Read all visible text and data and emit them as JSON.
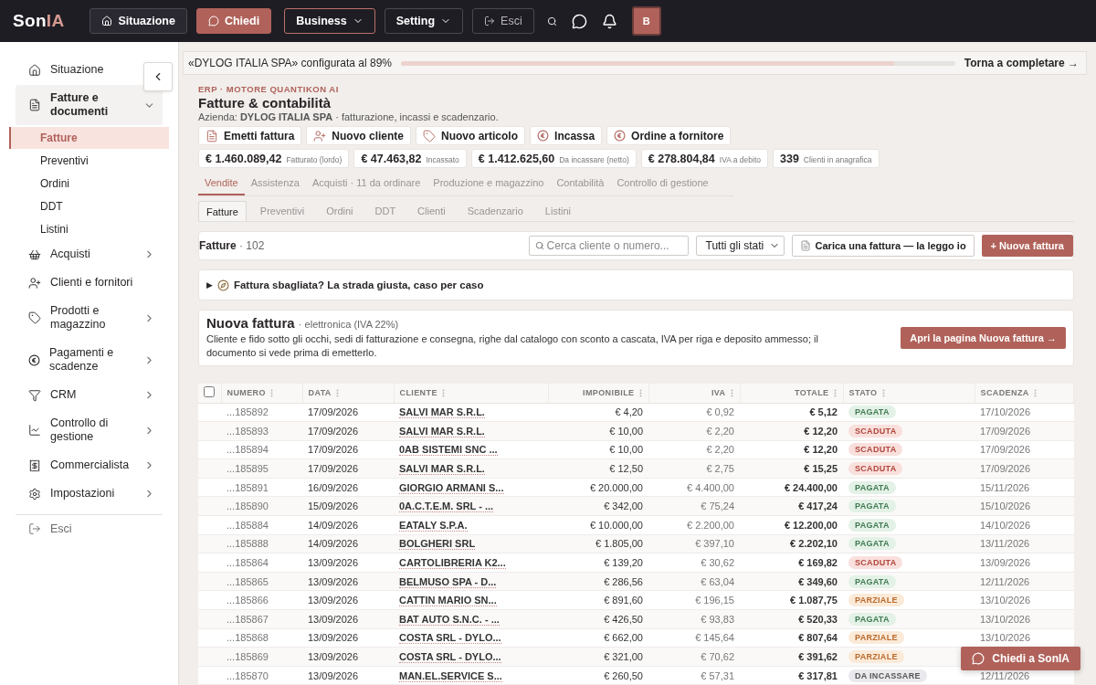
{
  "topbar": {
    "logo": {
      "text": "Son",
      "accent": "IA"
    },
    "nav": [
      {
        "label": "Situazione",
        "kind": "home"
      },
      {
        "label": "Chiedi",
        "kind": "primary"
      },
      {
        "label": "Business",
        "kind": "menu",
        "selected": true
      },
      {
        "label": "Setting",
        "kind": "menu",
        "selected": false
      },
      {
        "label": "Esci",
        "kind": "logout"
      }
    ],
    "avatar": "B"
  },
  "sidebar": {
    "items": [
      {
        "label": "Situazione",
        "kind": "link",
        "selected": false
      },
      {
        "label": "Fatture e documenti",
        "kind": "group",
        "selected": true,
        "expanded": true,
        "children": [
          {
            "label": "Fatture",
            "selected": true
          },
          {
            "label": "Preventivi",
            "selected": false
          },
          {
            "label": "Ordini",
            "selected": false
          },
          {
            "label": "DDT",
            "selected": false
          },
          {
            "label": "Listini",
            "selected": false
          }
        ]
      },
      {
        "label": "Acquisti",
        "kind": "group",
        "selected": false,
        "expanded": false
      },
      {
        "label": "Clienti e fornitori",
        "kind": "link",
        "selected": false
      },
      {
        "label": "Prodotti e magazzino",
        "kind": "group",
        "selected": false,
        "expanded": false
      },
      {
        "label": "Pagamenti e scadenze",
        "kind": "group",
        "selected": false,
        "expanded": false
      },
      {
        "label": "CRM",
        "kind": "group",
        "selected": false,
        "expanded": false
      },
      {
        "label": "Controllo di gestione",
        "kind": "group",
        "selected": false,
        "expanded": false
      },
      {
        "label": "Commercialista",
        "kind": "group",
        "selected": false,
        "expanded": false
      },
      {
        "label": "Impostazioni",
        "kind": "group",
        "selected": false,
        "expanded": false
      }
    ],
    "footer": "Esci"
  },
  "setup_banner": {
    "text": "«DYLOG ITALIA SPA» configurata al 89%",
    "level": 0.89,
    "link": "Torna a completare →"
  },
  "header": {
    "eyebrow": "ERP · MOTORE QUANTIKON AI",
    "title": "Fatture & contabilità",
    "subtitle": "Azienda: **DYLOG ITALIA SPA** · fatturazione, incassi e scadenzario."
  },
  "actions": [
    "Emetti fattura",
    "Nuovo cliente",
    "Nuovo articolo",
    "Incassa",
    "Ordine a fornitore"
  ],
  "kpis": [
    {
      "value": "€ 1.460.089,42",
      "label": "Fatturato (lordo)"
    },
    {
      "value": "€ 47.463,82",
      "label": "Incassato"
    },
    {
      "value": "€ 1.412.625,60",
      "label": "Da incassare (netto)"
    },
    {
      "value": "€ 278.804,84",
      "label": "IVA a debito"
    },
    {
      "value": "339",
      "label": "Clienti in anagrafica"
    }
  ],
  "tabs": [
    {
      "label": "Vendite",
      "selected": true
    },
    {
      "label": "Assistenza",
      "selected": false
    },
    {
      "label": "Acquisti · 11 da ordinare",
      "selected": false
    },
    {
      "label": "Produzione e magazzino",
      "selected": false
    },
    {
      "label": "Contabilità",
      "selected": false
    },
    {
      "label": "Controllo di gestione",
      "selected": false
    }
  ],
  "subtabs": [
    {
      "label": "Fatture",
      "selected": true
    },
    {
      "label": "Preventivi",
      "selected": false
    },
    {
      "label": "Ordini",
      "selected": false
    },
    {
      "label": "DDT",
      "selected": false
    },
    {
      "label": "Clienti",
      "selected": false
    },
    {
      "label": "Scadenzario",
      "selected": false
    },
    {
      "label": "Listini",
      "selected": false
    }
  ],
  "toolbar": {
    "title": "Fatture",
    "count": "· 102",
    "search_placeholder": "Cerca cliente o numero...",
    "filter": "Tutti gli stati",
    "upload": "Carica una fattura — la leggo io",
    "new": "+ Nuova fattura"
  },
  "help": {
    "marker": "▶",
    "text": "Fattura sbagliata? La strada giusta, caso per caso",
    "expanded": false
  },
  "new_invoice": {
    "title": "Nuova fattura",
    "subtitle": "· elettronica (IVA 22%)",
    "description": "Cliente e fido sotto gli occhi, sedi di fatturazione e consegna, righe dal catalogo con sconto a cascata, IVA per riga e deposito ammesso; il documento si vede prima di emetterlo.",
    "button": "Apri la pagina Nuova fattura →"
  },
  "table": {
    "select_all_checked": false,
    "columns": [
      "NUMERO",
      "DATA",
      "CLIENTE",
      "IMPONIBILE",
      "IVA",
      "TOTALE",
      "STATO",
      "SCADENZA"
    ],
    "rows": [
      {
        "numero": "...185892",
        "data": "17/09/2026",
        "cliente": "SALVI MAR S.R.L.",
        "imponibile": "€ 4,20",
        "iva": "€ 0,92",
        "totale": "€ 5,12",
        "stato": "PAGATA",
        "kind": "paid",
        "scadenza": "17/10/2026"
      },
      {
        "numero": "...185893",
        "data": "17/09/2026",
        "cliente": "SALVI MAR S.R.L.",
        "imponibile": "€ 10,00",
        "iva": "€ 2,20",
        "totale": "€ 12,20",
        "stato": "SCADUTA",
        "kind": "overdue",
        "scadenza": "17/09/2026"
      },
      {
        "numero": "...185894",
        "data": "17/09/2026",
        "cliente": "0AB SISTEMI SNC ...",
        "imponibile": "€ 10,00",
        "iva": "€ 2,20",
        "totale": "€ 12,20",
        "stato": "SCADUTA",
        "kind": "overdue",
        "scadenza": "17/09/2026"
      },
      {
        "numero": "...185895",
        "data": "17/09/2026",
        "cliente": "SALVI MAR S.R.L.",
        "imponibile": "€ 12,50",
        "iva": "€ 2,75",
        "totale": "€ 15,25",
        "stato": "SCADUTA",
        "kind": "overdue",
        "scadenza": "17/09/2026"
      },
      {
        "numero": "...185891",
        "data": "16/09/2026",
        "cliente": "GIORGIO ARMANI S...",
        "imponibile": "€ 20.000,00",
        "iva": "€ 4.400,00",
        "totale": "€ 24.400,00",
        "stato": "PAGATA",
        "kind": "paid",
        "scadenza": "15/11/2026"
      },
      {
        "numero": "...185890",
        "data": "15/09/2026",
        "cliente": "0A.C.T.E.M. SRL - ...",
        "imponibile": "€ 342,00",
        "iva": "€ 75,24",
        "totale": "€ 417,24",
        "stato": "PAGATA",
        "kind": "paid",
        "scadenza": "15/10/2026"
      },
      {
        "numero": "...185884",
        "data": "14/09/2026",
        "cliente": "EATALY S.P.A.",
        "imponibile": "€ 10.000,00",
        "iva": "€ 2.200,00",
        "totale": "€ 12.200,00",
        "stato": "PAGATA",
        "kind": "paid",
        "scadenza": "14/10/2026"
      },
      {
        "numero": "...185888",
        "data": "14/09/2026",
        "cliente": "BOLGHERI SRL",
        "imponibile": "€ 1.805,00",
        "iva": "€ 397,10",
        "totale": "€ 2.202,10",
        "stato": "PAGATA",
        "kind": "paid",
        "scadenza": "13/11/2026"
      },
      {
        "numero": "...185864",
        "data": "13/09/2026",
        "cliente": "CARTOLIBRERIA K2...",
        "imponibile": "€ 139,20",
        "iva": "€ 30,62",
        "totale": "€ 169,82",
        "stato": "SCADUTA",
        "kind": "overdue",
        "scadenza": "13/09/2026"
      },
      {
        "numero": "...185865",
        "data": "13/09/2026",
        "cliente": "BELMUSO SPA - D...",
        "imponibile": "€ 286,56",
        "iva": "€ 63,04",
        "totale": "€ 349,60",
        "stato": "PAGATA",
        "kind": "paid",
        "scadenza": "12/11/2026"
      },
      {
        "numero": "...185866",
        "data": "13/09/2026",
        "cliente": "CATTIN MARIO SN...",
        "imponibile": "€ 891,60",
        "iva": "€ 196,15",
        "totale": "€ 1.087,75",
        "stato": "PARZIALE",
        "kind": "partial",
        "scadenza": "13/10/2026"
      },
      {
        "numero": "...185867",
        "data": "13/09/2026",
        "cliente": "BAT AUTO S.N.C. - ...",
        "imponibile": "€ 426,50",
        "iva": "€ 93,83",
        "totale": "€ 520,33",
        "stato": "PAGATA",
        "kind": "paid",
        "scadenza": "13/10/2026"
      },
      {
        "numero": "...185868",
        "data": "13/09/2026",
        "cliente": "COSTA SRL - DYLO...",
        "imponibile": "€ 662,00",
        "iva": "€ 145,64",
        "totale": "€ 807,64",
        "stato": "PARZIALE",
        "kind": "partial",
        "scadenza": "13/10/2026"
      },
      {
        "numero": "...185869",
        "data": "13/09/2026",
        "cliente": "COSTA SRL - DYLO...",
        "imponibile": "€ 321,00",
        "iva": "€ 70,62",
        "totale": "€ 391,62",
        "stato": "PARZIALE",
        "kind": "partial"
      },
      {
        "numero": "...185870",
        "data": "13/09/2026",
        "cliente": "MAN.EL.SERVICE S...",
        "imponibile": "€ 260,50",
        "iva": "€ 57,31",
        "totale": "€ 317,81",
        "stato": "DA INCASSARE",
        "kind": "open",
        "scadenza": "12/11/2026"
      }
    ]
  },
  "chat_button": "Chiedi a SonIA"
}
